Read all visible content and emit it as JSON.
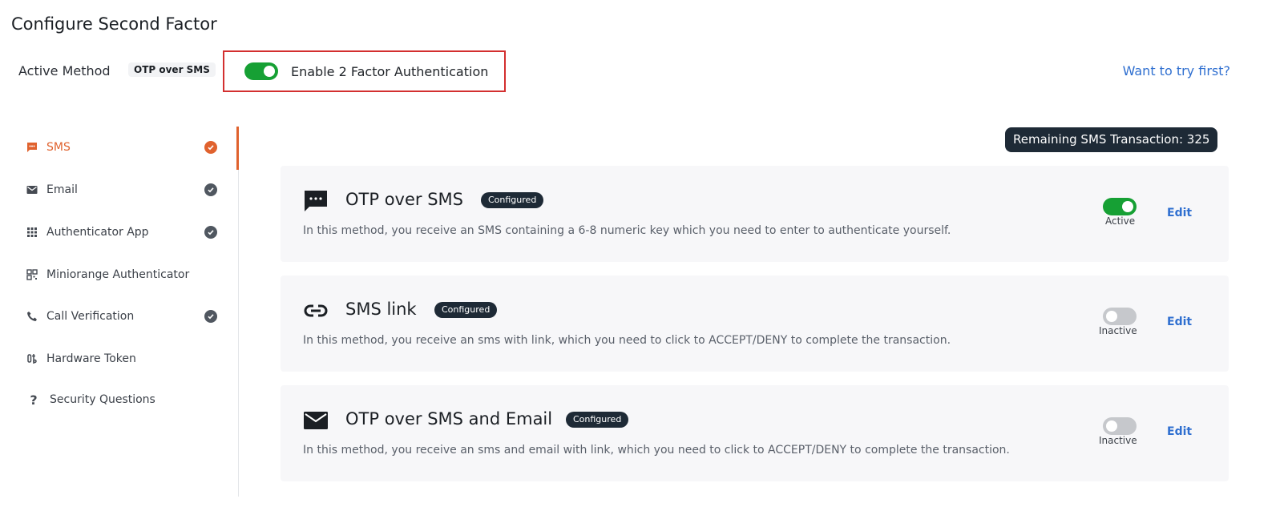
{
  "header": {
    "title": "Configure Second Factor",
    "active_method_label": "Active Method",
    "active_method_value": "OTP over SMS",
    "enable_2fa_label": "Enable 2 Factor Authentication",
    "enable_2fa_on": true,
    "try_link": "Want to try first?"
  },
  "sidebar": {
    "items": [
      {
        "label": "SMS",
        "icon": "sms-icon",
        "configured": true,
        "active": true
      },
      {
        "label": "Email",
        "icon": "email-icon",
        "configured": true,
        "active": false
      },
      {
        "label": "Authenticator App",
        "icon": "apps-grid-icon",
        "configured": true,
        "active": false
      },
      {
        "label": "Miniorange Authenticator",
        "icon": "qr-code-icon",
        "configured": false,
        "active": false
      },
      {
        "label": "Call Verification",
        "icon": "phone-icon",
        "configured": true,
        "active": false
      },
      {
        "label": "Hardware Token",
        "icon": "hardware-token-icon",
        "configured": false,
        "active": false
      },
      {
        "label": "Security Questions",
        "icon": "question-icon",
        "configured": false,
        "active": false
      }
    ]
  },
  "main": {
    "remaining_sms": "Remaining SMS Transaction: 325",
    "methods": [
      {
        "icon": "sms-bubble-icon",
        "title": "OTP over SMS",
        "badge": "Configured",
        "description": "In this method, you receive an SMS containing a 6-8 numeric key which you need to enter to authenticate yourself.",
        "enabled": true,
        "status": "Active",
        "edit_label": "Edit"
      },
      {
        "icon": "link-icon",
        "title": "SMS link",
        "badge": "Configured",
        "description": "In this method, you receive an sms with link, which you need to click to ACCEPT/DENY to complete the transaction.",
        "enabled": false,
        "status": "Inactive",
        "edit_label": "Edit"
      },
      {
        "icon": "envelope-icon",
        "title": "OTP over SMS and Email",
        "badge": "Configured",
        "description": "In this method, you receive an sms and email with link, which you need to click to ACCEPT/DENY to complete the transaction.",
        "enabled": false,
        "status": "Inactive",
        "edit_label": "Edit"
      }
    ]
  },
  "colors": {
    "accent": "#e0622e",
    "toggle_on": "#16a034",
    "toggle_off": "#c6c8cc",
    "link": "#2f6fd0",
    "highlight_border": "#d32f2f",
    "badge_dark": "#1e2a36"
  }
}
